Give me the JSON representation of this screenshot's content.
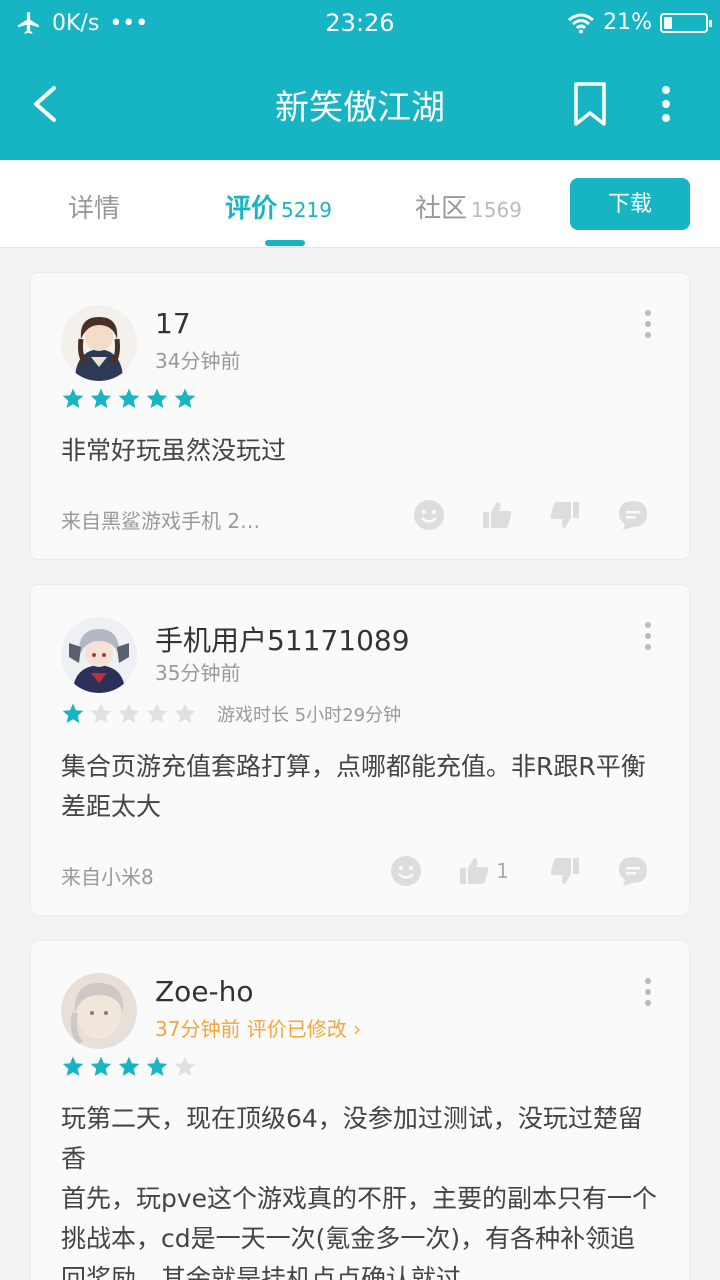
{
  "statusbar": {
    "speed": "0K/s",
    "dots": "•••",
    "time": "23:26",
    "battery_text": "21%",
    "battery_level": 0.21
  },
  "appbar": {
    "title": "新笑傲江湖",
    "back_icon": "back-arrow-icon",
    "bookmark_icon": "bookmark-icon",
    "more_icon": "more-vert-icon"
  },
  "tabs": [
    {
      "label": "详情",
      "count": ""
    },
    {
      "label": "评价",
      "count": "5219"
    },
    {
      "label": "社区",
      "count": "1569"
    }
  ],
  "download_label": "下载",
  "colors": {
    "accent": "#17b5c4",
    "orange": "#f5a53a",
    "star_off": "#e0e0e0"
  },
  "reviews": [
    {
      "name": "17",
      "time": "34分钟前",
      "rating": 5,
      "playtime": "",
      "content": "非常好玩虽然没玩过",
      "source": "来自黑鲨游戏手机 2…",
      "likes": ""
    },
    {
      "name": "手机用户51171089",
      "time": "35分钟前",
      "rating": 1,
      "playtime": "游戏时长 5小时29分钟",
      "content": "集合页游充值套路打算，点哪都能充值。非R跟R平衡差距太大",
      "source": "来自小米8",
      "likes": "1"
    },
    {
      "name": "Zoe-ho",
      "time": "37分钟前 评价已修改 ›",
      "rating": 4,
      "playtime": "",
      "content": "玩第二天，现在顶级64，没参加过测试，没玩过楚留香\n首先，玩pve这个游戏真的不肝，主要的副本只有一个挑战本，cd是一天一次(氪金多一次)，有各种补领追回奖励，其余就是挂机点点确认就过",
      "source": "",
      "likes": ""
    }
  ]
}
